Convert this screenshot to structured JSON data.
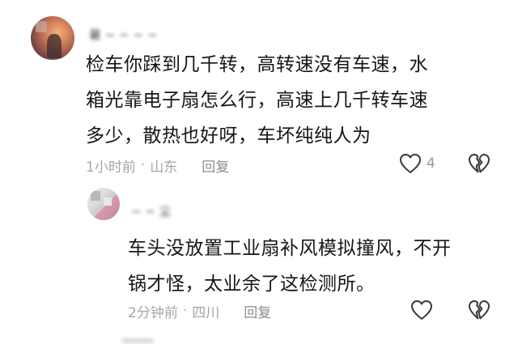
{
  "comments": [
    {
      "username": "暑 ~ ~ ~ ~",
      "text_lines": [
        "检车你踩到几千转，高转速没有车速，水",
        "箱光靠电子扇怎么行，高速上几千转车速",
        "多少，散热也好呀，车坏纯纯人为"
      ],
      "time": "1小时前",
      "separator": "·",
      "location": "山东",
      "reply_label": "回复",
      "like_count": "4"
    },
    {
      "username": "~ ~ 尘",
      "text_lines": [
        "车头没放置工业扇补风模拟撞风，不开",
        "锅才怪，太业余了这检测所。"
      ],
      "time": "2分钟前",
      "separator": "·",
      "location": "四川",
      "reply_label": "回复",
      "like_count": ""
    }
  ],
  "icons": {
    "like": "heart-outline-icon",
    "dislike": "broken-heart-icon"
  },
  "colors": {
    "text": "#161616",
    "meta": "#a6a6a6",
    "reply": "#8e8e8e",
    "icon": "#3a3a3a"
  }
}
